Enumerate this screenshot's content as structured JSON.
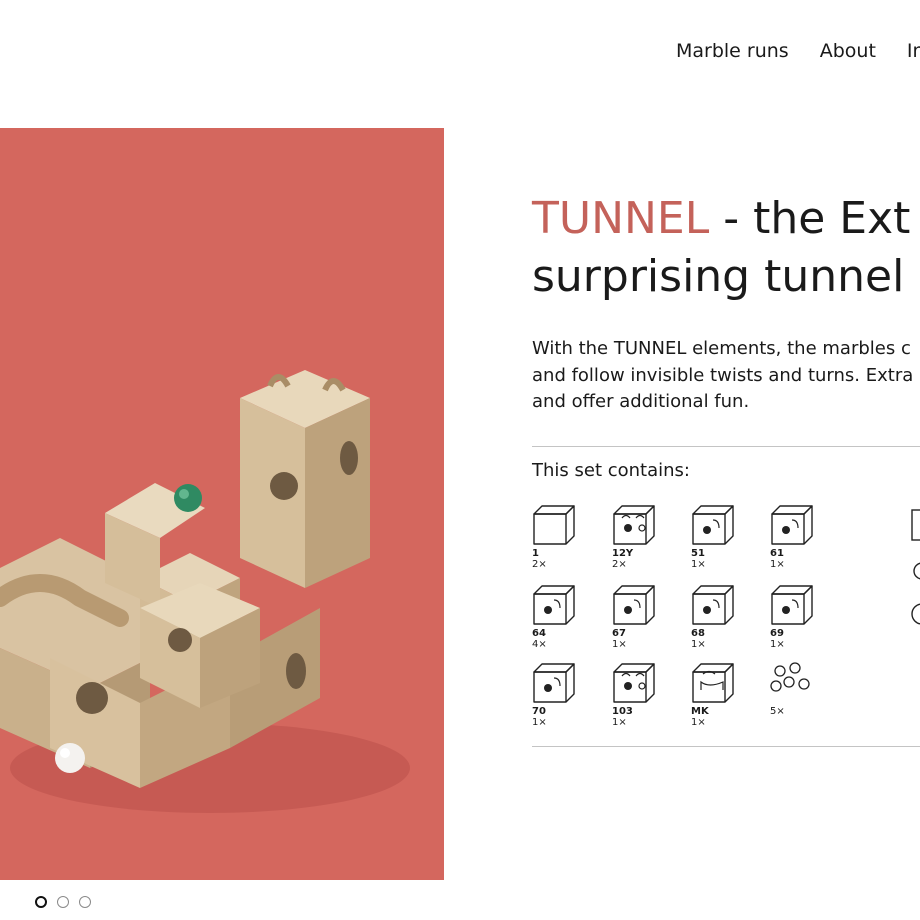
{
  "nav": {
    "items": [
      "Marble runs",
      "About",
      "In"
    ]
  },
  "hero": {
    "background_color": "#d4675e",
    "carousel_dots": 3,
    "active_dot": 0
  },
  "product": {
    "title_accent": "TUNNEL",
    "title_line1_rest": " - the Ext",
    "title_line2": "surprising tunnel s",
    "description_lines": [
      "With the TUNNEL elements, the marbles c",
      "and follow invisible twists and turns. Extra",
      "and offer additional fun."
    ],
    "set_heading": "This set contains:",
    "accent_color": "#c4625a"
  },
  "pieces": [
    {
      "code": "1",
      "qty": "2×",
      "icon": "plain-cube-icon"
    },
    {
      "code": "12Y",
      "qty": "2×",
      "icon": "junction-cube-icon"
    },
    {
      "code": "51",
      "qty": "1×",
      "icon": "tunnel-cube-icon"
    },
    {
      "code": "61",
      "qty": "1×",
      "icon": "tunnel-cube-icon"
    },
    {
      "code": "64",
      "qty": "4×",
      "icon": "tunnel-cube-icon"
    },
    {
      "code": "67",
      "qty": "1×",
      "icon": "tunnel-cube-icon"
    },
    {
      "code": "68",
      "qty": "1×",
      "icon": "tunnel-cube-icon"
    },
    {
      "code": "69",
      "qty": "1×",
      "icon": "tunnel-cube-icon"
    },
    {
      "code": "70",
      "qty": "1×",
      "icon": "tunnel-cube-icon"
    },
    {
      "code": "103",
      "qty": "1×",
      "icon": "junction-cube-icon"
    },
    {
      "code": "MK",
      "qty": "1×",
      "icon": "curve-cube-icon"
    },
    {
      "code": "",
      "qty": "5×",
      "icon": "marbles-icon"
    }
  ]
}
